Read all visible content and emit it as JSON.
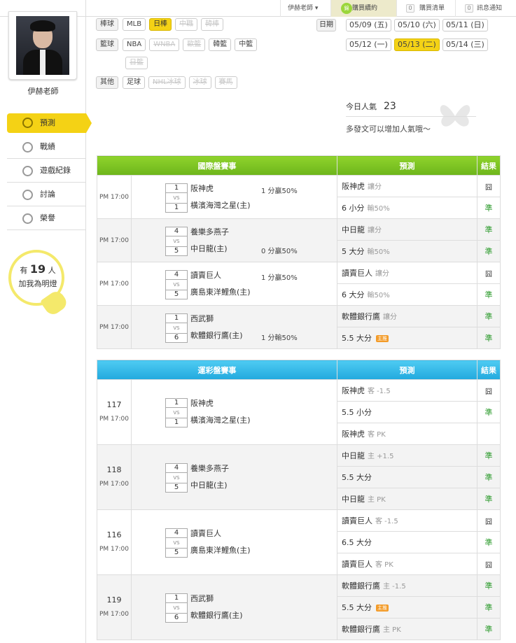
{
  "topbar": {
    "user_label": "伊赫老師 ▾",
    "buy_icon": "錦",
    "buy_label": "購買續約",
    "list_count": "0",
    "list_label": "購買清單",
    "msg_count": "0",
    "msg_label": "訊息通知"
  },
  "sidebar": {
    "teacher_name": "伊赫老師",
    "nav": [
      {
        "label": "預測",
        "active": true
      },
      {
        "label": "戰績"
      },
      {
        "label": "遊戲紀錄"
      },
      {
        "label": "討論"
      },
      {
        "label": "榮譽"
      }
    ],
    "fans_prefix": "有",
    "fans_count": "19",
    "fans_suffix": "人",
    "fans_line2": "加我為明燈"
  },
  "filters": {
    "baseball_label": "棒球",
    "baseball_tags": [
      "MLB",
      "日棒",
      "中職",
      "韓棒"
    ],
    "basketball_label": "籃球",
    "basketball_tags": [
      "NBA",
      "WNBA",
      "歐籃",
      "韓籃",
      "中籃",
      "日籃"
    ],
    "other_label": "其他",
    "other_tags": [
      "足球",
      "NHL冰球",
      "冰球",
      "賽馬"
    ]
  },
  "dates": {
    "label": "日期",
    "items": [
      "05/09 (五)",
      "05/10 (六)",
      "05/11 (日)",
      "05/12 (一)",
      "05/13 (二)",
      "05/14 (三)"
    ]
  },
  "popularity": {
    "label": "今日人氣",
    "value": "23",
    "hint": "多發文可以增加人氣哦～"
  },
  "intl_table": {
    "header_match": "國際盤賽事",
    "header_pred": "預測",
    "header_result": "結果",
    "rows": [
      {
        "time": "PM 17:00",
        "s1": "1",
        "s2": "1",
        "vs": "VS",
        "team1": "阪神虎",
        "team2": "橫濱海灣之星(主)",
        "res": "1 分贏50%",
        "p1": "阪神虎",
        "p1g": "讓分",
        "r1": "囧",
        "p2": "6 小分",
        "p2g": "輸50%",
        "r2": "準"
      },
      {
        "time": "PM 17:00",
        "s1": "4",
        "s2": "5",
        "vs": "VS",
        "team1": "養樂多燕子",
        "team2": "中日龍(主)",
        "res": "0 分贏50%",
        "p1": "中日龍",
        "p1g": "讓分",
        "r1": "準",
        "p2": "5 大分",
        "p2g": "輸50%",
        "r2": "準"
      },
      {
        "time": "PM 17:00",
        "s1": "4",
        "s2": "5",
        "vs": "VS",
        "team1": "讀賣巨人",
        "team2": "廣島東洋鯉魚(主)",
        "res": "1 分贏50%",
        "p1": "讀賣巨人",
        "p1g": "讓分",
        "r1": "囧",
        "p2": "6 大分",
        "p2g": "輸50%",
        "r2": "準"
      },
      {
        "time": "PM 17:00",
        "s1": "1",
        "s2": "6",
        "vs": "VS",
        "team1": "西武獅",
        "team2": "軟體銀行鷹(主)",
        "res": "1 分輸50%",
        "p1": "軟體銀行鷹",
        "p1g": "讓分",
        "r1": "準",
        "p2": "5.5 大分",
        "p2g": "",
        "p2badge": "主推",
        "r2": "準"
      }
    ]
  },
  "lottery_table": {
    "header_match": "運彩盤賽事",
    "header_pred": "預測",
    "header_result": "結果",
    "rows": [
      {
        "no": "117",
        "time": "PM 17:00",
        "s1": "1",
        "s2": "1",
        "vs": "VS",
        "team1": "阪神虎",
        "team2": "橫濱海灣之星(主)",
        "preds": [
          {
            "t": "阪神虎",
            "g": "客 -1.5",
            "r": "囧"
          },
          {
            "t": "5.5 小分",
            "g": "",
            "r": "準"
          },
          {
            "t": "阪神虎",
            "g": "客 PK",
            "r": ""
          }
        ]
      },
      {
        "no": "118",
        "time": "PM 17:00",
        "s1": "4",
        "s2": "5",
        "vs": "VS",
        "team1": "養樂多燕子",
        "team2": "中日龍(主)",
        "preds": [
          {
            "t": "中日龍",
            "g": "主 +1.5",
            "r": "準"
          },
          {
            "t": "5.5 大分",
            "g": "",
            "r": "準"
          },
          {
            "t": "中日龍",
            "g": "主 PK",
            "r": "準"
          }
        ]
      },
      {
        "no": "116",
        "time": "PM 17:00",
        "s1": "4",
        "s2": "5",
        "vs": "VS",
        "team1": "讀賣巨人",
        "team2": "廣島東洋鯉魚(主)",
        "preds": [
          {
            "t": "讀賣巨人",
            "g": "客 -1.5",
            "r": "囧"
          },
          {
            "t": "6.5 大分",
            "g": "",
            "r": "準"
          },
          {
            "t": "讀賣巨人",
            "g": "客 PK",
            "r": "囧"
          }
        ]
      },
      {
        "no": "119",
        "time": "PM 17:00",
        "s1": "1",
        "s2": "6",
        "vs": "VS",
        "team1": "西武獅",
        "team2": "軟體銀行鷹(主)",
        "preds": [
          {
            "t": "軟體銀行鷹",
            "g": "主 -1.5",
            "r": "準"
          },
          {
            "t": "5.5 大分",
            "g": "",
            "badge": "主推",
            "r": "準"
          },
          {
            "t": "軟體銀行鷹",
            "g": "主 PK",
            "r": "準"
          }
        ]
      }
    ]
  },
  "colors": {
    "accent_yellow": "#f4d215",
    "green_header": "#7bc225",
    "blue_header": "#2db3e6",
    "win_green": "#2b9a2b"
  }
}
